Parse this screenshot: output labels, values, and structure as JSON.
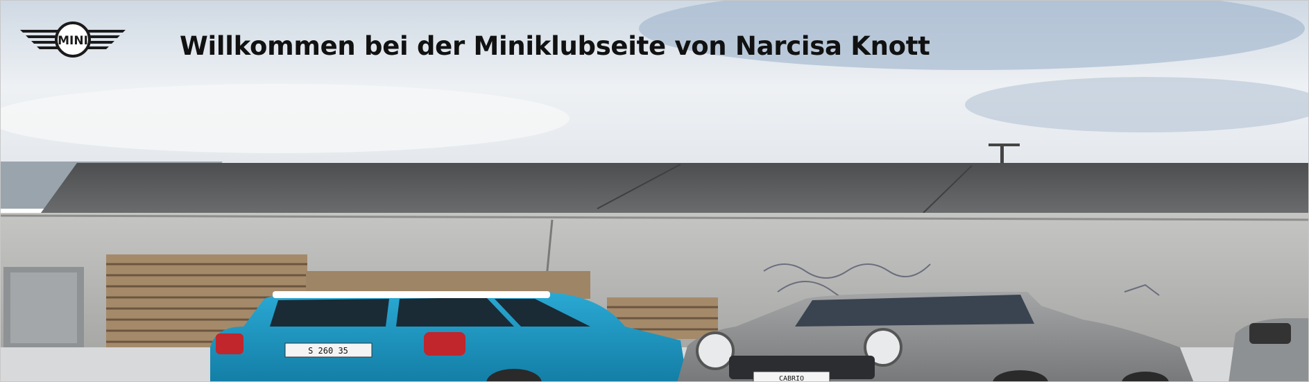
{
  "header": {
    "logo_text": "MINI",
    "title": "Willkommen bei der Miniklubseite von Narcisa Knott"
  },
  "hero": {
    "car_left_plate": "S 260 35",
    "car_right_plate": "CABRIO"
  },
  "colors": {
    "sky": "#dfe6ee",
    "roof": "#5c5e60",
    "wall": "#b9b9b7",
    "car_left": "#1a9bc8",
    "car_right": "#8a8c8d",
    "title": "#111111"
  },
  "icons": [
    "mini-logo-icon"
  ]
}
